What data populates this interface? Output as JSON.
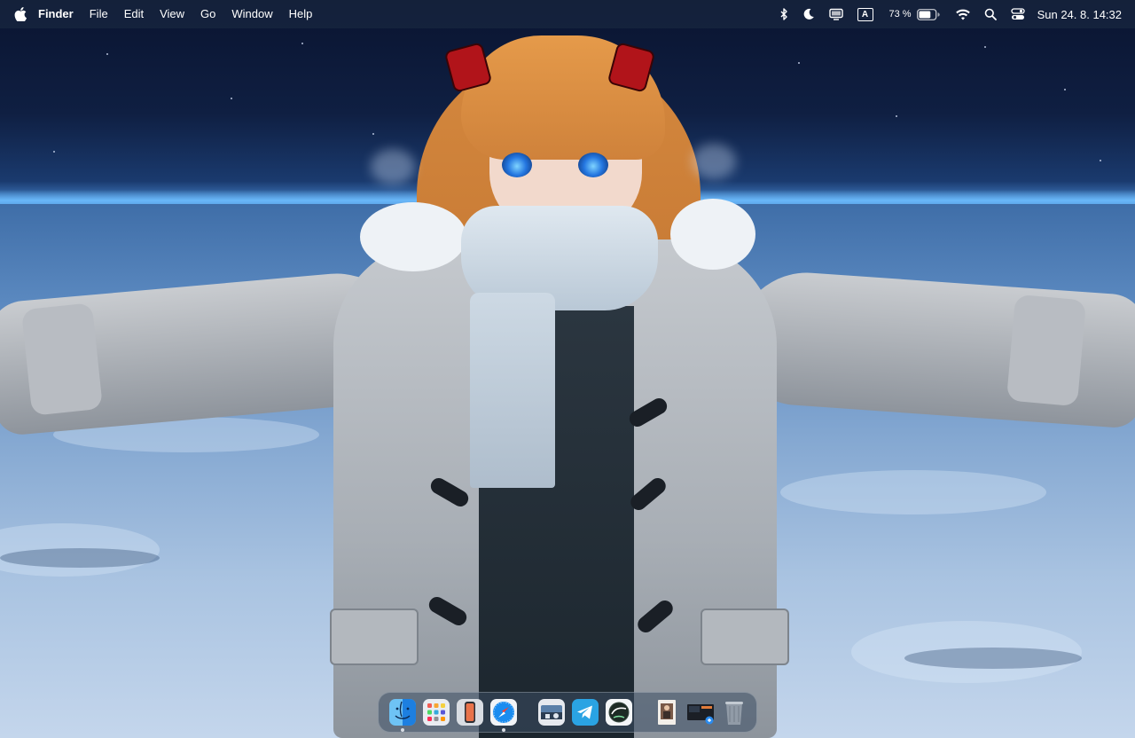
{
  "menubar": {
    "apple_icon": "apple-logo-icon",
    "app_name": "Finder",
    "menus": [
      "File",
      "Edit",
      "View",
      "Go",
      "Window",
      "Help"
    ],
    "status": {
      "bluetooth_icon": "bluetooth-icon",
      "focus_icon": "moon-icon",
      "display_icon": "display-icon",
      "input_source_label": "A",
      "battery_percent": "73 %",
      "battery_level": 0.73,
      "wifi_icon": "wifi-icon",
      "spotlight_icon": "search-icon",
      "control_center_icon": "control-center-icon",
      "clock": "Sun 24. 8.  14:32"
    }
  },
  "dock": {
    "apps": [
      {
        "name": "Finder",
        "icon": "finder-icon",
        "running": true
      },
      {
        "name": "Launchpad",
        "icon": "launchpad-icon",
        "running": false
      },
      {
        "name": "iPhone Mirroring",
        "icon": "iphone-mirroring-icon",
        "running": false
      },
      {
        "name": "Safari",
        "icon": "safari-icon",
        "running": true
      }
    ],
    "apps2": [
      {
        "name": "Preview",
        "icon": "preview-icon",
        "running": false
      },
      {
        "name": "Telegram",
        "icon": "telegram-icon",
        "running": false
      },
      {
        "name": "Activity",
        "icon": "activity-icon",
        "running": false
      }
    ],
    "stacks": [
      {
        "name": "Document",
        "icon": "document-thumbnail-icon"
      },
      {
        "name": "Screenshot",
        "icon": "screenshot-thumbnail-icon"
      },
      {
        "name": "Trash",
        "icon": "trash-icon"
      }
    ]
  },
  "colors": {
    "menubar_bg": "#1e2c44",
    "accent_blue": "#2a8cf0"
  }
}
